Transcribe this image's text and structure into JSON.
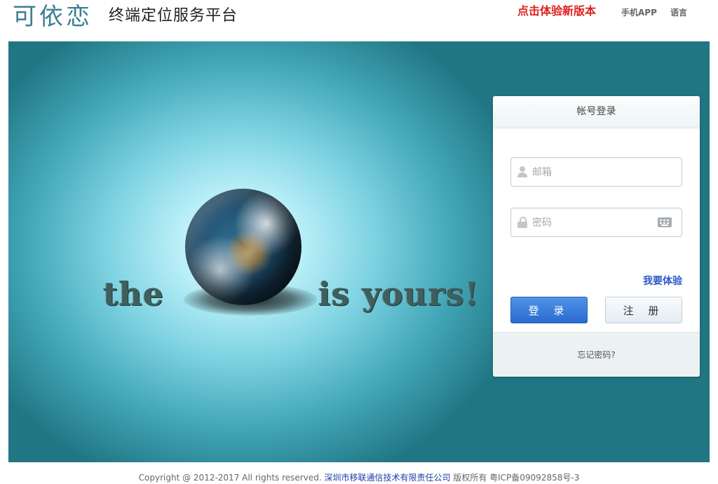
{
  "header": {
    "brand": "可依恋",
    "subtitle": "终端定位服务平台",
    "new_version": "点击体验新版本",
    "nav_app": "手机APP",
    "nav_language": "语言"
  },
  "banner": {
    "slogan_left": "the",
    "slogan_right": "is yours!"
  },
  "login": {
    "title": "帐号登录",
    "email_placeholder": "邮箱",
    "password_placeholder": "密码",
    "email_value": "",
    "password_value": "",
    "try_label": "我要体验",
    "login_label": "登 录",
    "register_label": "注 册",
    "forgot_label": "忘记密码?"
  },
  "footer": {
    "copyright": "Copyright @ 2012-2017 All rights reserved.",
    "company": "深圳市移联通信技术有限责任公司",
    "rights": "版权所有 粤ICP备09092858号-3"
  },
  "colors": {
    "brand": "#3d7f92",
    "new_version": "#e02020",
    "link": "#2d58c7",
    "login_button": "#2a6ad1"
  },
  "icons": [
    "user-icon",
    "lock-icon",
    "keyboard-icon",
    "globe-image"
  ]
}
